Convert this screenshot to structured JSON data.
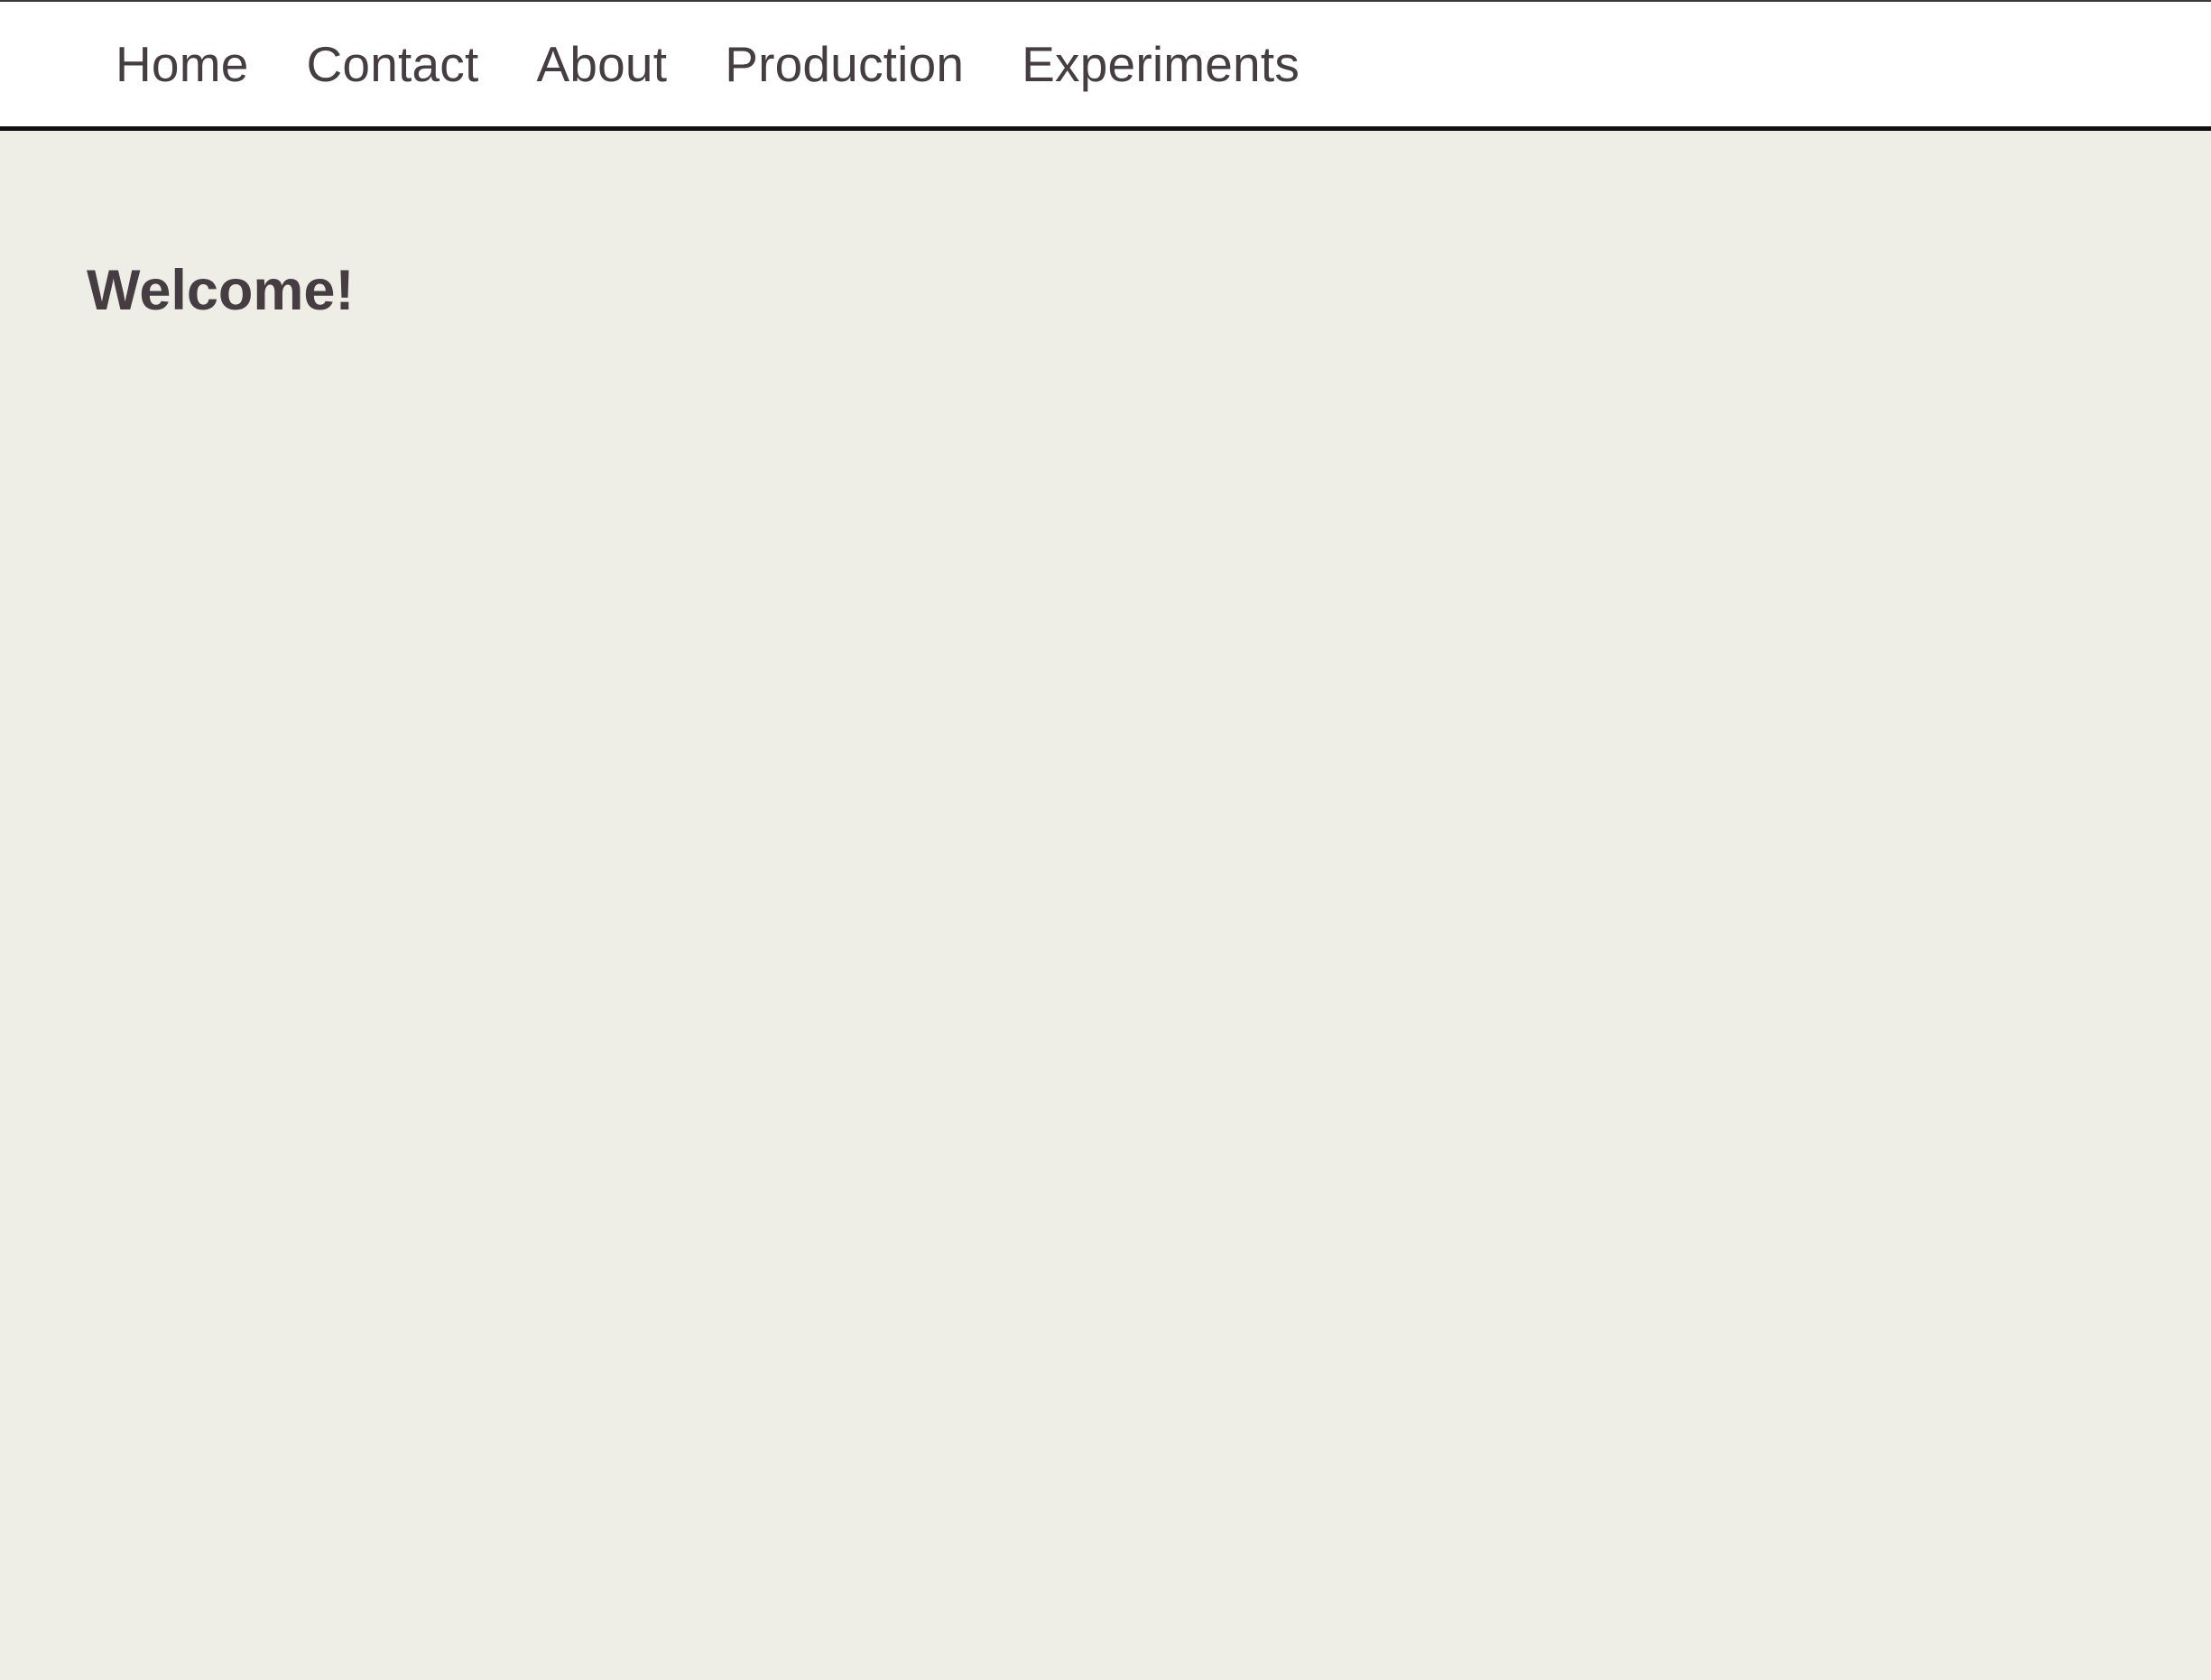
{
  "nav": {
    "items": [
      {
        "label": "Home"
      },
      {
        "label": "Contact"
      },
      {
        "label": "About"
      },
      {
        "label": "Production"
      },
      {
        "label": "Experiments"
      }
    ]
  },
  "main": {
    "title": "Welcome!"
  },
  "colors": {
    "background": "#eeeee7",
    "navbar_background": "#ffffff",
    "text": "#453d42",
    "navbar_border": "#111111"
  }
}
